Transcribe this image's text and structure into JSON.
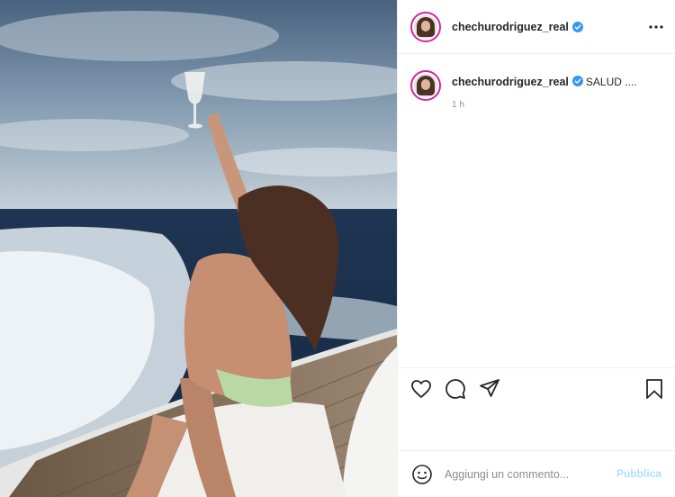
{
  "post": {
    "username": "chechurodriguez_real",
    "verified": true,
    "caption": {
      "username": "chechurodriguez_real",
      "text": "SALUD ....",
      "time": "1 h"
    },
    "comment": {
      "placeholder": "Aggiungi un commento...",
      "publish_label": "Pubblica"
    }
  },
  "icons": {
    "more": "more-options-icon",
    "like": "heart-icon",
    "comment": "comment-icon",
    "share": "share-icon",
    "save": "bookmark-icon",
    "emoji": "emoji-icon",
    "verified": "verified-badge-icon"
  },
  "colors": {
    "verified_blue": "#3897f0",
    "publish_disabled": "#b2dffc",
    "story_ring": "#d6249f"
  }
}
